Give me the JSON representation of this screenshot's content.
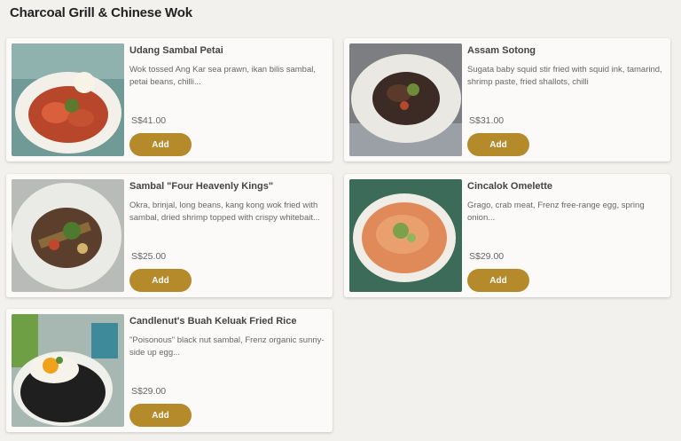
{
  "section": {
    "title": "Charcoal Grill & Chinese Wok"
  },
  "theme": {
    "accent": "#b48a2b",
    "card_bg": "#fbfaf8",
    "page_bg": "#f2f1ee"
  },
  "items": [
    {
      "name": "Udang Sambal Petai",
      "description": "Wok tossed Ang Kar sea prawn, ikan bilis sambal, petai beans, chilli...",
      "price": "S$41.00",
      "add_label": "Add",
      "image_icon": "dish-photo-icon"
    },
    {
      "name": "Assam Sotong",
      "description": "Sugata baby squid stir fried with squid ink, tamarind, shrimp paste, fried shallots, chilli",
      "price": "S$31.00",
      "add_label": "Add",
      "image_icon": "dish-photo-icon"
    },
    {
      "name": "Sambal \"Four Heavenly Kings\"",
      "description": "Okra, brinjal, long beans, kang kong wok fried with sambal, dried shrimp topped with crispy whitebait...",
      "price": "S$25.00",
      "add_label": "Add",
      "image_icon": "dish-photo-icon"
    },
    {
      "name": "Cincalok Omelette",
      "description": "Grago, crab meat, Frenz free-range egg, spring onion...",
      "price": "S$29.00",
      "add_label": "Add",
      "image_icon": "dish-photo-icon"
    },
    {
      "name": "Candlenut's Buah Keluak Fried Rice",
      "description": "\"Poisonous\" black nut sambal, Frenz organic sunny-side up egg...",
      "price": "S$29.00",
      "add_label": "Add",
      "image_icon": "dish-photo-icon"
    }
  ]
}
